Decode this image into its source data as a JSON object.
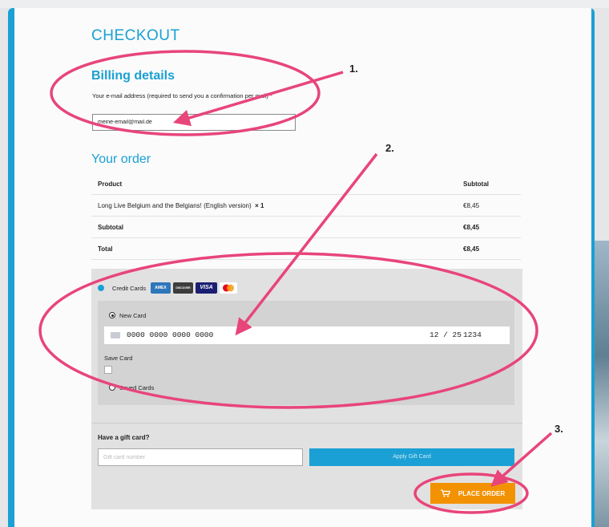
{
  "checkout_title": "CHECKOUT",
  "billing": {
    "heading": "Billing details",
    "email_label": "Your e-mail address (required to send you a confirmation per mail)",
    "required_mark": "*",
    "email_value": "meine-email@mail.de"
  },
  "order": {
    "heading": "Your order",
    "columns": [
      "Product",
      "Subtotal"
    ],
    "item": {
      "name": "Long Live Belgium and the Belgians! (English version)",
      "qty": "× 1",
      "price": "€8,45"
    },
    "subtotal": {
      "label": "Subtotal",
      "value": "€8,45"
    },
    "total": {
      "label": "Total",
      "value": "€8,45"
    }
  },
  "payment": {
    "method_label": "Credit Cards",
    "card_logos": [
      {
        "name": "amex",
        "label": "AMEX",
        "color": "#2e77bb"
      },
      {
        "name": "discover",
        "label": "DISCOVER",
        "color": "#3d3d3d"
      },
      {
        "name": "visa",
        "label": "VISA",
        "color": "#1a1f71"
      },
      {
        "name": "mastercard",
        "label": "",
        "color": "#ffffff"
      }
    ],
    "new_card_label": "New Card",
    "card_number": "0000 0000 0000 0000",
    "expiry": "12 / 25",
    "cvc": "1234",
    "save_card_label": "Save Card",
    "saved_cards_label": "Saved Cards"
  },
  "gift": {
    "heading": "Have a gift card?",
    "placeholder": "Gift card number",
    "apply_label": "Apply Gift Card"
  },
  "place_order_label": "PLACE ORDER",
  "annotations": [
    "1.",
    "2.",
    "3."
  ],
  "colors": {
    "accent": "#1aa0d4",
    "order_button": "#f39200",
    "annotation": "#e8457a"
  }
}
